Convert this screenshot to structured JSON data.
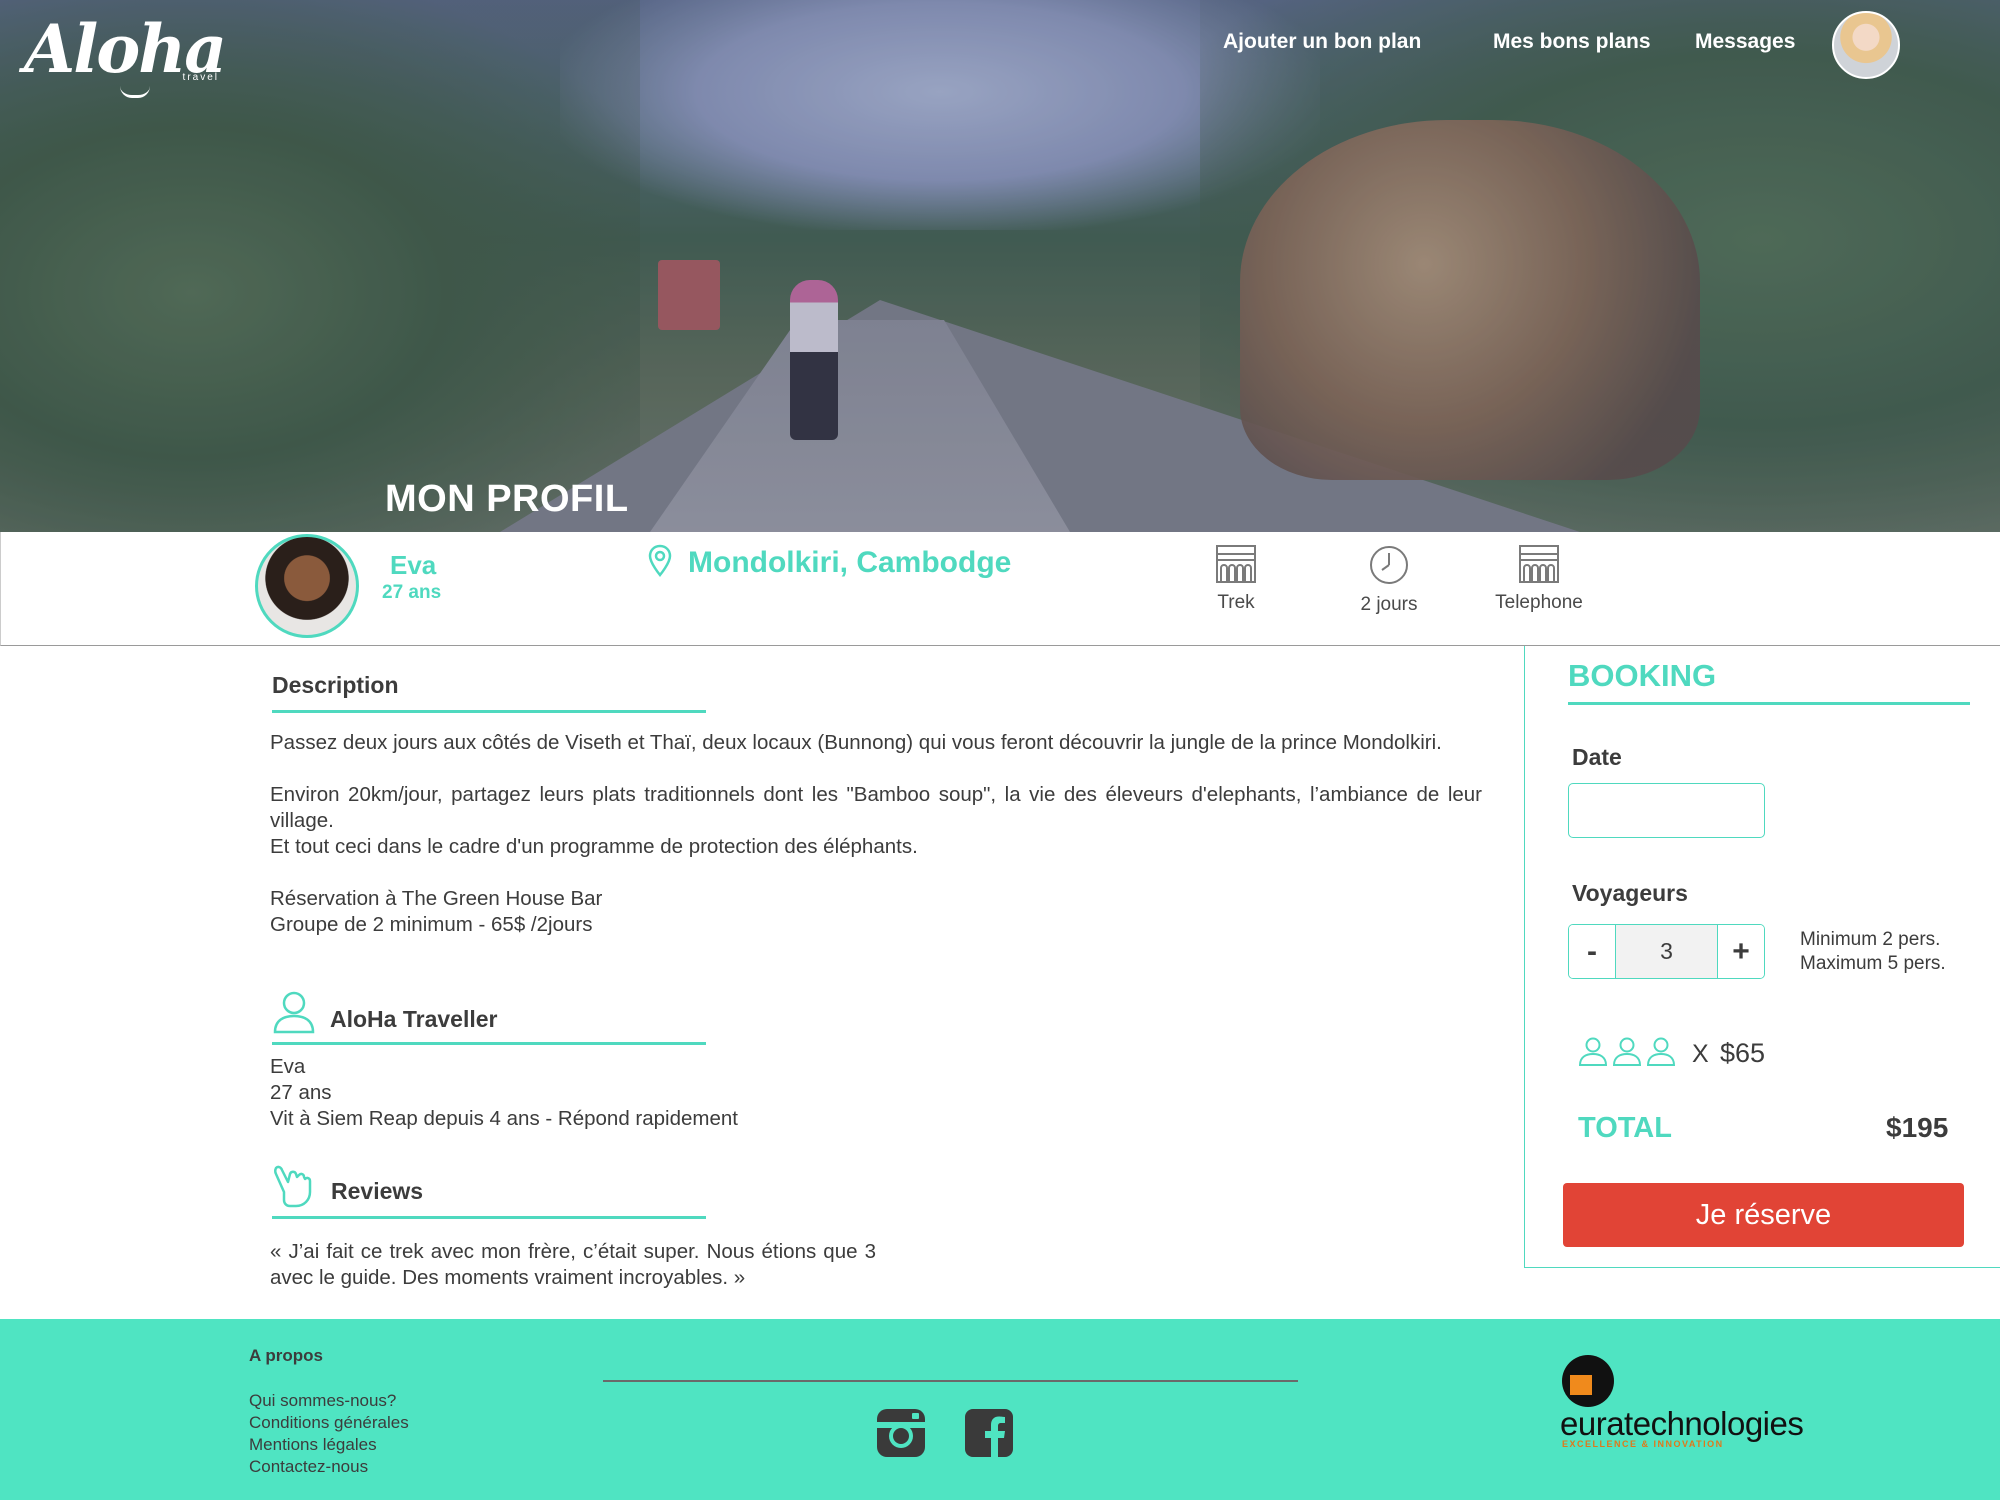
{
  "header": {
    "logo_text": "Aloha",
    "logo_sub": "travel",
    "nav": [
      "Ajouter un bon plan",
      "Mes bons plans",
      "Messages"
    ],
    "page_title": "MON PROFIL"
  },
  "profile": {
    "name": "Eva",
    "age": "27 ans",
    "location": "Mondolkiri, Cambodge",
    "features": [
      {
        "icon": "building-icon",
        "label": "Trek"
      },
      {
        "icon": "clock-icon",
        "label": "2 jours"
      },
      {
        "icon": "building-icon",
        "label": "Telephone"
      }
    ]
  },
  "description": {
    "heading": "Description",
    "paragraphs": [
      "Passez deux  jours aux côtés de Viseth et Thaï, deux locaux (Bunnong) qui vous feront découvrir la jungle  de la prince Mondolkiri.",
      "Environ  20km/jour, partagez leurs plats traditionnels dont les \"Bamboo soup\", la vie des éleveurs d'elephants, l’ambiance de leur village.",
      "Et tout ceci dans le cadre d'un programme de protection des éléphants.",
      "Réservation à The Green House Bar",
      "Groupe de 2 minimum - 65$ /2jours"
    ]
  },
  "traveller": {
    "heading": "AloHa Traveller",
    "lines": [
      "Eva",
      "27 ans",
      "Vit à Siem Reap depuis 4 ans - Répond rapidement"
    ]
  },
  "reviews": {
    "heading": "Reviews",
    "text": "« J’ai fait ce trek avec mon frère, c’était super. Nous étions que 3 avec le guide. Des moments vraiment incroyables. »"
  },
  "booking": {
    "title": "BOOKING",
    "date_label": "Date",
    "date_value": "",
    "travellers_label": "Voyageurs",
    "decrement": "-",
    "increment": "+",
    "travellers_count": "3",
    "min_text": "Minimum 2 pers.",
    "max_text": "Maximum 5 pers.",
    "times": "X",
    "unit_price": "$65",
    "total_label": "TOTAL",
    "total_value": "$195",
    "cta": "Je réserve"
  },
  "footer": {
    "about_heading": "A propos",
    "links": [
      "Qui sommes-nous?",
      "Conditions générales",
      "Mentions légales",
      "Contactez-nous"
    ],
    "partner_name": "euratechnologies",
    "partner_tagline": "EXCELLENCE & INNOVATION"
  },
  "colors": {
    "accent": "#4fd9bf",
    "footer_bg": "#4fe4c2",
    "cta": "#e14436",
    "text": "#3c3c3c"
  }
}
